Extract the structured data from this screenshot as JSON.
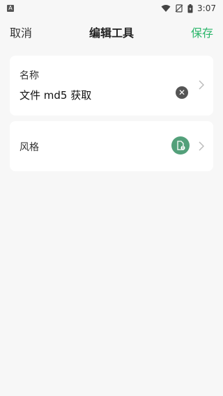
{
  "status_bar": {
    "time": "3:07",
    "icons": [
      "app-a-icon",
      "wifi-icon",
      "no-sim-icon",
      "battery-icon"
    ]
  },
  "header": {
    "cancel_label": "取消",
    "title": "编辑工具",
    "save_label": "保存",
    "accent_color": "#2bb66a"
  },
  "name_card": {
    "label": "名称",
    "value": "文件 md5 获取"
  },
  "style_card": {
    "label": "风格",
    "icon": "file-info-icon",
    "icon_color": "#53a07a"
  }
}
